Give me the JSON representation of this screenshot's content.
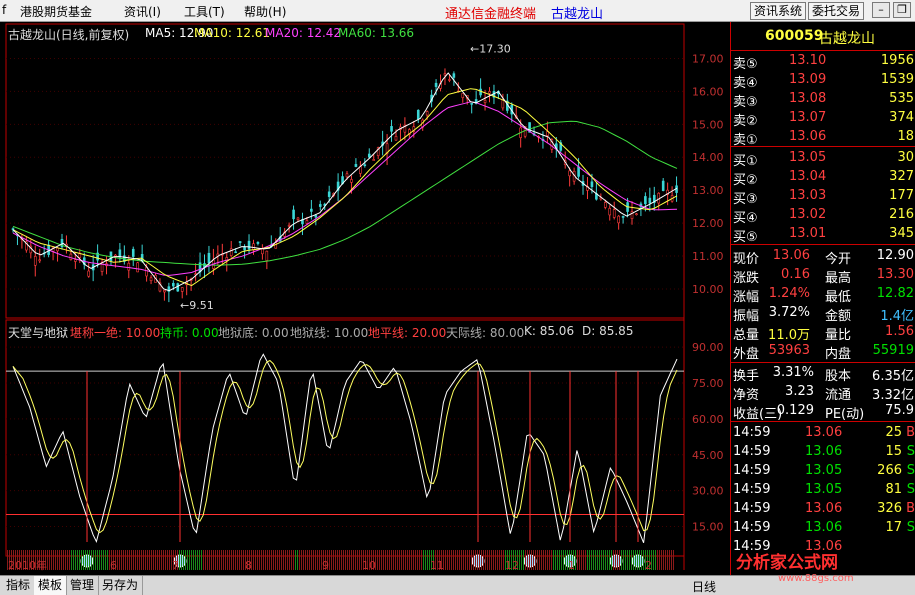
{
  "menu": {
    "items": [
      "f",
      "港股期货基金",
      "资讯(I)",
      "工具(T)",
      "帮助(H)"
    ],
    "app_title": "通达信金融终端",
    "app_stock": "古越龙山",
    "buttons": [
      "资讯系统",
      "委托交易"
    ],
    "window_controls": [
      "minimize-icon",
      "restore-icon"
    ]
  },
  "chart_header": {
    "title": "古越龙山(日线,前复权)",
    "ma5": "MA5: 12.90",
    "ma10": "MA10: 12.61",
    "ma20": "MA20: 12.42",
    "ma60": "MA60: 13.66"
  },
  "indicator_header": {
    "name": "天堂与地狱",
    "items": [
      {
        "text": "堪称一绝: 10.00",
        "color": "#ff4040"
      },
      {
        "text": "持币: 0.00",
        "color": "#00e000"
      },
      {
        "text": "地狱底: 0.00",
        "color": "#aaaaaa"
      },
      {
        "text": "地狱线: 10.00",
        "color": "#aaaaaa"
      },
      {
        "text": "地平线: 20.00",
        "color": "#ff4040"
      },
      {
        "text": "天际线: 80.00",
        "color": "#aaaaaa"
      },
      {
        "text": "K: 85.06",
        "color": "#dddddd"
      },
      {
        "text": "D: 85.85",
        "color": "#dddddd"
      }
    ]
  },
  "chart_data": [
    {
      "type": "candlestick",
      "title": "古越龙山(日线,前复权)",
      "ylim": [
        9.3,
        17.5
      ],
      "y_ticks": [
        "17.00",
        "16.00",
        "15.00",
        "14.00",
        "13.00",
        "12.00",
        "11.00",
        "10.00"
      ],
      "annotations": [
        "17.30",
        "9.51"
      ],
      "x_ticks": [
        "2010年",
        "6",
        "7",
        "8",
        "9",
        "10",
        "11",
        "12",
        "1",
        "2"
      ],
      "series": [
        {
          "name": "MA5",
          "color": "#ffffff"
        },
        {
          "name": "MA10",
          "color": "#ffff40"
        },
        {
          "name": "MA20",
          "color": "#ff40ff"
        },
        {
          "name": "MA60",
          "color": "#40e040"
        }
      ],
      "ma60_values": [
        11.9,
        11.6,
        11.3,
        11.1,
        10.95,
        10.85,
        10.8,
        10.75,
        10.72,
        10.75,
        10.85,
        11.0,
        11.2,
        11.5,
        11.9,
        12.4,
        12.9,
        13.4,
        13.9,
        14.4,
        14.8,
        15.05,
        15.1,
        14.9,
        14.5,
        14.0,
        13.66
      ],
      "ma20_values": [
        11.7,
        11.3,
        11.0,
        10.8,
        10.7,
        10.6,
        10.4,
        10.5,
        10.8,
        11.0,
        11.3,
        11.7,
        12.2,
        12.8,
        13.5,
        14.2,
        14.9,
        15.5,
        15.7,
        15.4,
        14.9,
        14.4,
        13.8,
        13.2,
        12.7,
        12.4,
        12.42
      ],
      "price_values": [
        11.8,
        11.0,
        11.4,
        10.6,
        11.0,
        10.9,
        9.9,
        10.3,
        11.0,
        11.3,
        11.2,
        12.0,
        12.3,
        13.3,
        14.0,
        14.8,
        15.2,
        16.6,
        15.6,
        16.0,
        14.9,
        14.6,
        13.4,
        12.8,
        12.2,
        12.6,
        13.06
      ]
    },
    {
      "type": "line",
      "title": "天堂与地狱",
      "ylim": [
        6,
        93
      ],
      "y_ticks": [
        "90.00",
        "75.00",
        "60.00",
        "45.00",
        "30.00",
        "15.00"
      ],
      "levels": {
        "天际线": 80,
        "地平线": 20
      },
      "k_values": [
        82,
        65,
        40,
        55,
        28,
        8,
        35,
        75,
        60,
        85,
        40,
        10,
        55,
        80,
        60,
        88,
        75,
        30,
        82,
        45,
        75,
        85,
        72,
        82,
        58,
        25,
        70,
        80,
        85,
        50,
        10,
        55,
        45,
        8,
        48,
        12,
        40,
        25,
        8,
        70,
        85
      ],
      "signals": [
        "6",
        "7",
        "12",
        "12",
        "1",
        "1",
        "2"
      ]
    }
  ],
  "quote": {
    "code": "600059",
    "name": "古越龙山",
    "sell": [
      {
        "label": "卖⑤",
        "price": "13.10",
        "vol": "1956"
      },
      {
        "label": "卖④",
        "price": "13.09",
        "vol": "1539"
      },
      {
        "label": "卖③",
        "price": "13.08",
        "vol": "535"
      },
      {
        "label": "卖②",
        "price": "13.07",
        "vol": "374"
      },
      {
        "label": "卖①",
        "price": "13.06",
        "vol": "18"
      }
    ],
    "buy": [
      {
        "label": "买①",
        "price": "13.05",
        "vol": "30"
      },
      {
        "label": "买②",
        "price": "13.04",
        "vol": "327"
      },
      {
        "label": "买③",
        "price": "13.03",
        "vol": "177"
      },
      {
        "label": "买④",
        "price": "13.02",
        "vol": "216"
      },
      {
        "label": "买⑤",
        "price": "13.01",
        "vol": "345"
      }
    ],
    "stats": [
      {
        "l1": "现价",
        "v1": "13.06",
        "c1": "#ff4040",
        "l2": "今开",
        "v2": "12.90",
        "c2": "#ffffff"
      },
      {
        "l1": "涨跌",
        "v1": "0.16",
        "c1": "#ff4040",
        "l2": "最高",
        "v2": "13.30",
        "c2": "#ff4040"
      },
      {
        "l1": "涨幅",
        "v1": "1.24%",
        "c1": "#ff4040",
        "l2": "最低",
        "v2": "12.82",
        "c2": "#00e000"
      },
      {
        "l1": "振幅",
        "v1": "3.72%",
        "c1": "#ffffff",
        "l2": "金额",
        "v2": "1.4亿",
        "c2": "#40c0ff"
      },
      {
        "l1": "总量",
        "v1": "11.0万",
        "c1": "#ffff40",
        "l2": "量比",
        "v2": "1.56",
        "c2": "#ff4040"
      },
      {
        "l1": "外盘",
        "v1": "53963",
        "c1": "#ff4040",
        "l2": "内盘",
        "v2": "55919",
        "c2": "#00e000"
      }
    ],
    "fundamentals": [
      {
        "l1": "换手",
        "v1": "3.31%",
        "l2": "股本",
        "v2": "6.35亿"
      },
      {
        "l1": "净资",
        "v1": "3.23",
        "l2": "流通",
        "v2": "3.32亿"
      },
      {
        "l1": "收益(三)",
        "v1": "0.129",
        "l2": "PE(动)",
        "v2": "75.9"
      }
    ],
    "ticks": [
      {
        "time": "14:59",
        "price": "13.06",
        "vol": "25",
        "dir": "B",
        "color": "#ff4040"
      },
      {
        "time": "14:59",
        "price": "13.06",
        "vol": "15",
        "dir": "S",
        "color": "#00e000"
      },
      {
        "time": "14:59",
        "price": "13.05",
        "vol": "266",
        "dir": "S",
        "color": "#00e000"
      },
      {
        "time": "14:59",
        "price": "13.05",
        "vol": "81",
        "dir": "S",
        "color": "#00e000"
      },
      {
        "time": "14:59",
        "price": "13.06",
        "vol": "326",
        "dir": "B",
        "color": "#ff4040"
      },
      {
        "time": "14:59",
        "price": "13.06",
        "vol": "17",
        "dir": "S",
        "color": "#00e000"
      },
      {
        "time": "14:59",
        "price": "13.06",
        "vol": "",
        "dir": "",
        "color": "#ff4040"
      }
    ]
  },
  "bottom_tabs": [
    "指标",
    "模板",
    "管理",
    "另存为"
  ],
  "bottom_right": "日线",
  "watermark": {
    "text": "分析家公式网",
    "url": "www.88gs.com"
  }
}
